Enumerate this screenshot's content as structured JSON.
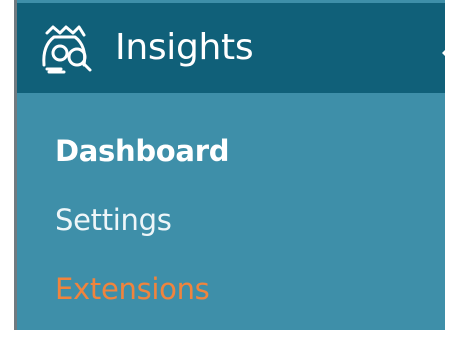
{
  "menu": {
    "title": "Insights",
    "icon": "insights-icon",
    "current_indicator_icon": "current-indicator-arrow-icon",
    "items": [
      {
        "label": "Dashboard",
        "state": "current"
      },
      {
        "label": "Settings",
        "state": "normal"
      },
      {
        "label": "Extensions",
        "state": "hover"
      }
    ]
  },
  "colors": {
    "header_bg": "#106079",
    "submenu_bg": "#3e8fa9",
    "current_text": "#ffffff",
    "normal_text": "#eef6f9",
    "hover_text": "#f0843d"
  }
}
